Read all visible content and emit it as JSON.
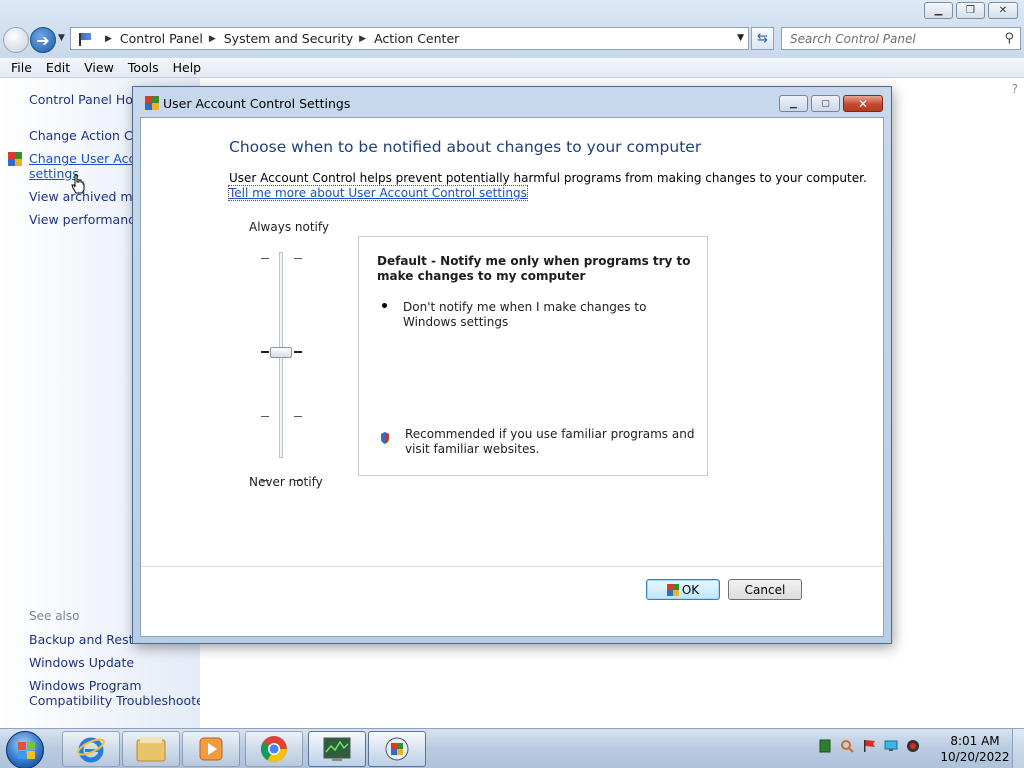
{
  "explorer": {
    "breadcrumb": [
      "Control Panel",
      "System and Security",
      "Action Center"
    ],
    "search_placeholder": "Search Control Panel",
    "menu": [
      "File",
      "Edit",
      "View",
      "Tools",
      "Help"
    ],
    "sidebar": {
      "home": "Control Panel Hom",
      "action_center": "Change Action Cen",
      "uac_line1": "Change User Accou",
      "uac_line2": "settings",
      "archived": "View archived mess",
      "performance": "View performance i",
      "see_also": "See also",
      "backup": "Backup and Restore",
      "windows_update": "Windows Update",
      "compat_line1": "Windows Program",
      "compat_line2": "Compatibility Troubleshooter"
    }
  },
  "dialog": {
    "title": "User Account Control Settings",
    "heading": "Choose when to be notified about changes to your computer",
    "description": "User Account Control helps prevent potentially harmful programs from making changes to your computer.",
    "link": "Tell me more about User Account Control settings",
    "slider": {
      "top_label": "Always notify",
      "bottom_label": "Never notify",
      "level": 2,
      "levels": 4
    },
    "info": {
      "title": "Default - Notify me only when programs try to make changes to my computer",
      "bullet": "Don't notify me when I make changes to Windows settings",
      "recommendation": "Recommended if you use familiar programs and visit familiar websites."
    },
    "ok_label": "OK",
    "cancel_label": "Cancel"
  },
  "taskbar": {
    "time": "8:01 AM",
    "date": "10/20/2022",
    "apps": [
      "internet-explorer",
      "windows-explorer",
      "windows-media-player",
      "google-chrome",
      "task-manager",
      "control-panel"
    ]
  },
  "colors": {
    "link": "#1b4fc6",
    "heading": "#1e3f7a",
    "sidebar_link": "#1e3287"
  }
}
